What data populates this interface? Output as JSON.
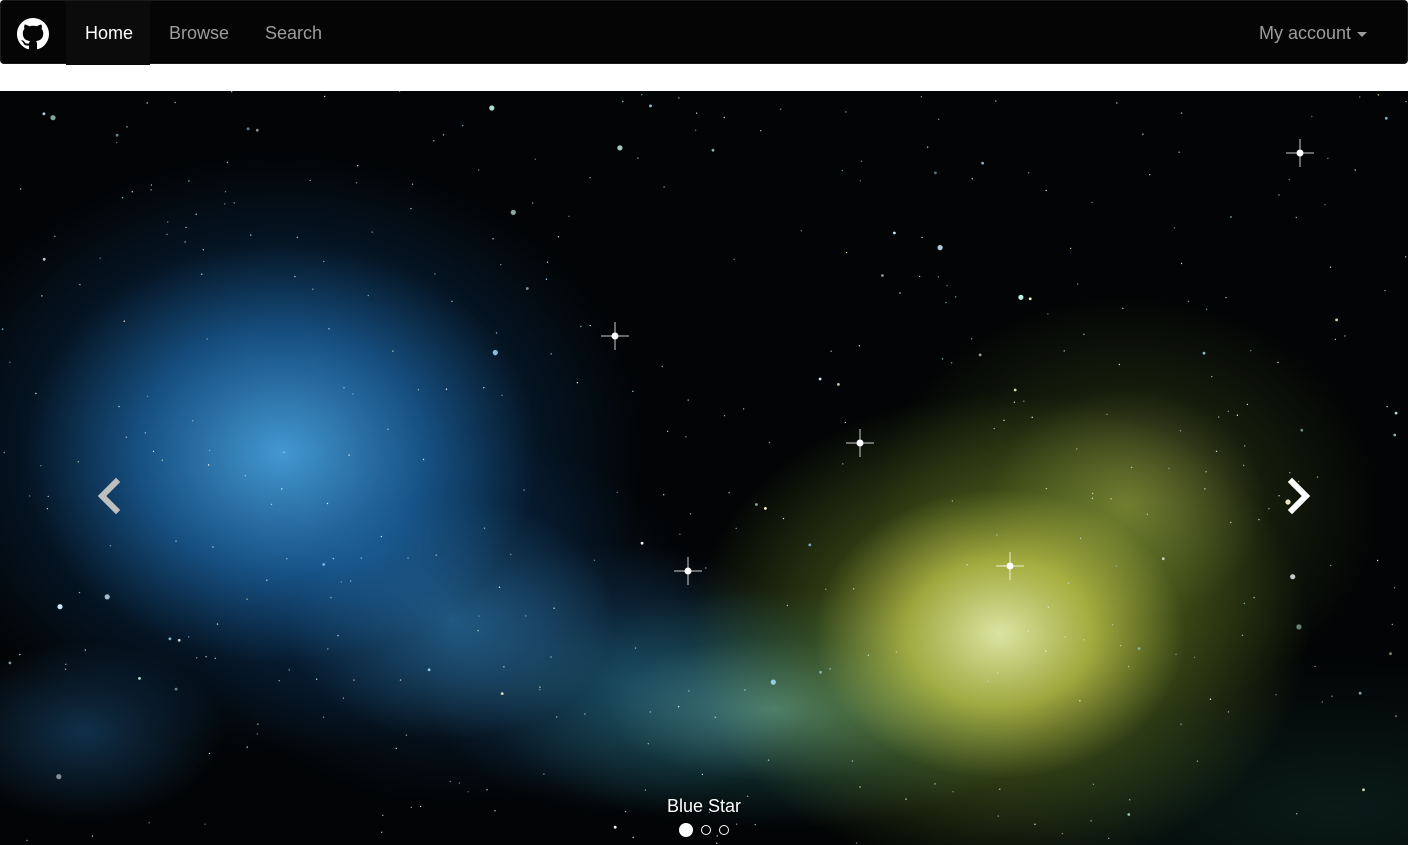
{
  "navbar": {
    "brand_icon": "github-icon",
    "items": [
      {
        "label": "Home",
        "active": true
      },
      {
        "label": "Browse",
        "active": false
      },
      {
        "label": "Search",
        "active": false
      }
    ],
    "account_label": "My account",
    "account_icon": "caret-down-icon"
  },
  "carousel": {
    "caption": "Blue Star",
    "slide_count": 3,
    "active_index": 0,
    "prev_icon": "chevron-left-icon",
    "next_icon": "chevron-right-icon"
  },
  "colors": {
    "navbar_bg": "#050505",
    "nav_text": "#9d9d9d",
    "nav_active_text": "#ffffff"
  }
}
